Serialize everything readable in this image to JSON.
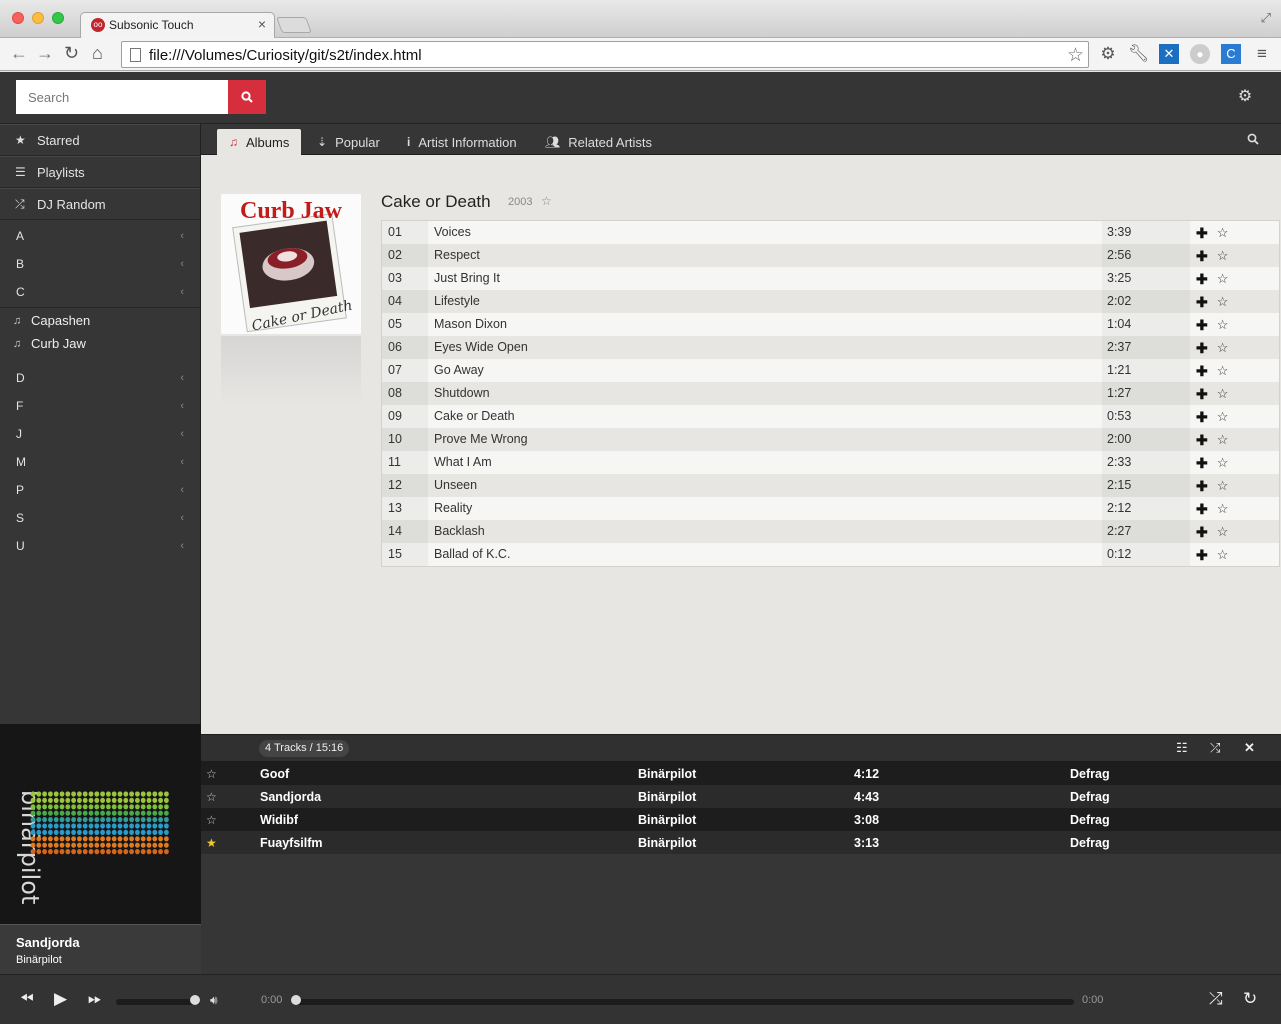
{
  "browser": {
    "tab_title": "Subsonic Touch",
    "url": "file:///Volumes/Curiosity/git/s2t/index.html"
  },
  "header": {
    "search_placeholder": "Search"
  },
  "sidebar": {
    "top_items": [
      {
        "label": "Starred",
        "icon": "star-icon"
      },
      {
        "label": "Playlists",
        "icon": "list-icon"
      },
      {
        "label": "DJ Random",
        "icon": "shuffle-icon"
      }
    ],
    "letters_before": [
      "A",
      "B",
      "C"
    ],
    "artists": [
      "Capashen",
      "Curb Jaw"
    ],
    "letters_after": [
      "D",
      "F",
      "J",
      "M",
      "P",
      "S",
      "U"
    ]
  },
  "tabs": [
    {
      "label": "Albums",
      "icon": "music-note-icon",
      "active": true
    },
    {
      "label": "Popular",
      "icon": "sort-icon",
      "active": false
    },
    {
      "label": "Artist Information",
      "icon": "info-icon",
      "active": false
    },
    {
      "label": "Related Artists",
      "icon": "users-icon",
      "active": false
    }
  ],
  "album": {
    "title": "Cake or Death",
    "year": "2003",
    "cover_text_top": "Curb Jaw",
    "cover_text_bottom": "Cake or Death",
    "tracks": [
      {
        "num": "01",
        "title": "Voices",
        "duration": "3:39"
      },
      {
        "num": "02",
        "title": "Respect",
        "duration": "2:56"
      },
      {
        "num": "03",
        "title": "Just Bring It",
        "duration": "3:25"
      },
      {
        "num": "04",
        "title": "Lifestyle",
        "duration": "2:02"
      },
      {
        "num": "05",
        "title": "Mason Dixon",
        "duration": "1:04"
      },
      {
        "num": "06",
        "title": "Eyes Wide Open",
        "duration": "2:37"
      },
      {
        "num": "07",
        "title": "Go Away",
        "duration": "1:21"
      },
      {
        "num": "08",
        "title": "Shutdown",
        "duration": "1:27"
      },
      {
        "num": "09",
        "title": "Cake or Death",
        "duration": "0:53"
      },
      {
        "num": "10",
        "title": "Prove Me Wrong",
        "duration": "2:00"
      },
      {
        "num": "11",
        "title": "What I Am",
        "duration": "2:33"
      },
      {
        "num": "12",
        "title": "Unseen",
        "duration": "2:15"
      },
      {
        "num": "13",
        "title": "Reality",
        "duration": "2:12"
      },
      {
        "num": "14",
        "title": "Backlash",
        "duration": "2:27"
      },
      {
        "num": "15",
        "title": "Ballad of K.C.",
        "duration": "0:12"
      }
    ]
  },
  "queue": {
    "summary": "4 Tracks / 15:16",
    "items": [
      {
        "title": "Goof",
        "artist": "Binärpilot",
        "duration": "4:12",
        "album": "Defrag",
        "starred": false
      },
      {
        "title": "Sandjorda",
        "artist": "Binärpilot",
        "duration": "4:43",
        "album": "Defrag",
        "starred": false
      },
      {
        "title": "Widibf",
        "artist": "Binärpilot",
        "duration": "3:08",
        "album": "Defrag",
        "starred": false
      },
      {
        "title": "Fuayfsilfm",
        "artist": "Binärpilot",
        "duration": "3:13",
        "album": "Defrag",
        "starred": true
      }
    ]
  },
  "now_playing": {
    "title": "Sandjorda",
    "artist": "Binärpilot",
    "logo_text": "binärpilot"
  },
  "player": {
    "elapsed": "0:00",
    "total": "0:00",
    "volume": 1.0,
    "progress": 0.0
  },
  "colors": {
    "accent": "#d62e3d",
    "star_active": "#f2c82e"
  }
}
